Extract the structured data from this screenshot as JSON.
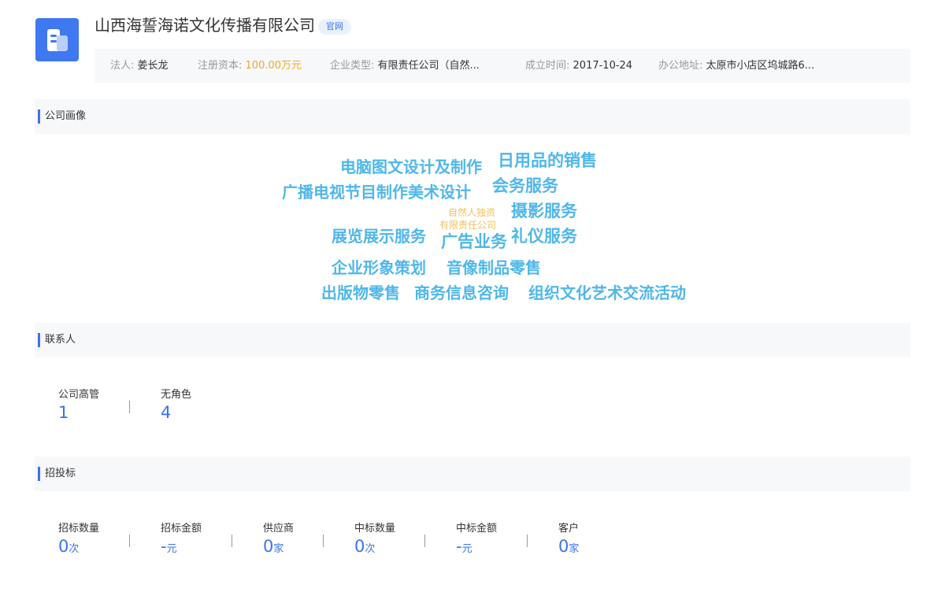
{
  "header": {
    "logo_icon": "building-icon",
    "company_name": "山西海誓海诺文化传播有限公司",
    "official_badge": "官网",
    "info": [
      {
        "key": "法人:",
        "value": "姜长龙"
      },
      {
        "key": "注册资本:",
        "value": "100.00万元"
      },
      {
        "key": "企业类型:",
        "value": "有限责任公司（自然..."
      },
      {
        "key": "成立时间:",
        "value": "2017-10-24"
      },
      {
        "key": "办公地址:",
        "value": "太原市小店区坞城路6..."
      }
    ],
    "accent_color": "#3a73ef",
    "capital_color": "#f5a623"
  },
  "portrait": {
    "title": "公司画像",
    "words": [
      "电脑图文设计及制作",
      "日用品的销售",
      "广播电视节目制作美术设计",
      "会务服务",
      "自然人独资",
      "摄影服务",
      "有限责任公司",
      "展览展示服务",
      "广告业务",
      "礼仪服务",
      "企业形象策划",
      "音像制品零售",
      "出版物零售",
      "商务信息咨询",
      "组织文化艺术交流活动"
    ],
    "word_color": "#4fb7ea",
    "tag_color": "#f3c15f"
  },
  "contacts": {
    "title": "联系人",
    "stats": [
      {
        "label": "公司高管",
        "value": "1"
      },
      {
        "label": "无角色",
        "value": "4"
      }
    ]
  },
  "bidding": {
    "title": "招投标",
    "stats": [
      {
        "label": "招标数量",
        "value": "0",
        "unit": "次"
      },
      {
        "label": "招标金额",
        "value": "-",
        "unit": "元"
      },
      {
        "label": "供应商",
        "value": "0",
        "unit": "家"
      },
      {
        "label": "中标数量",
        "value": "0",
        "unit": "次"
      },
      {
        "label": "中标金额",
        "value": "-",
        "unit": "元"
      },
      {
        "label": "客户",
        "value": "0",
        "unit": "家"
      }
    ]
  }
}
